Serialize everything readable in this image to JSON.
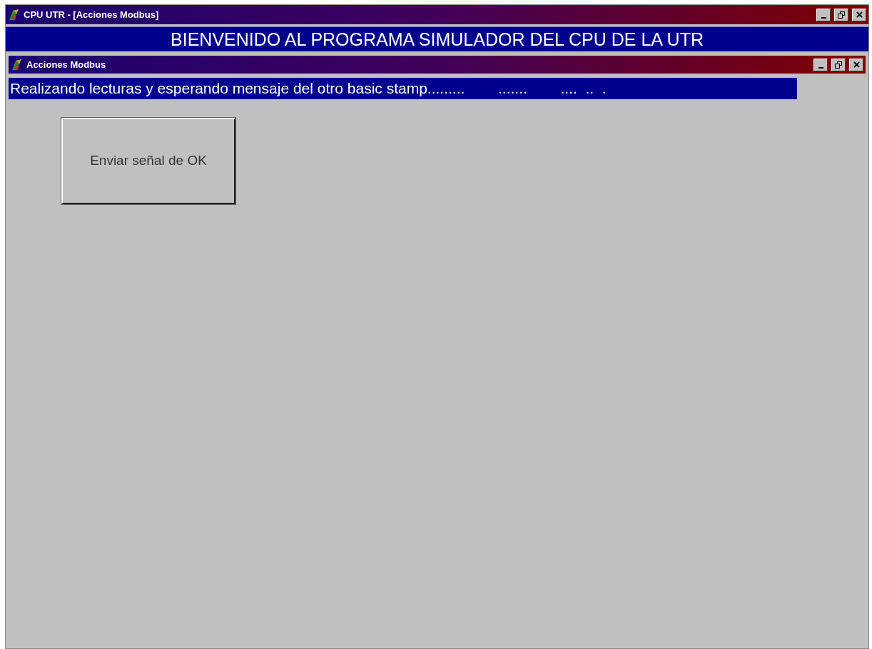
{
  "window": {
    "title": "CPU UTR - [Acciones Modbus]",
    "controls": [
      {
        "kind": "minimize"
      },
      {
        "kind": "restore"
      },
      {
        "kind": "close"
      }
    ]
  },
  "banner": "BIENVENIDO AL PROGRAMA SIMULADOR DEL CPU DE LA UTR",
  "child_window": {
    "title": "Acciones Modbus",
    "controls": [
      {
        "kind": "minimize"
      },
      {
        "kind": "restore"
      },
      {
        "kind": "close"
      }
    ],
    "status_message": "Realizando lecturas y esperando mensaje del otro basic stamp.........        .......        ....  ..  .",
    "buttons": [
      {
        "label": "Enviar señal de OK"
      }
    ]
  }
}
